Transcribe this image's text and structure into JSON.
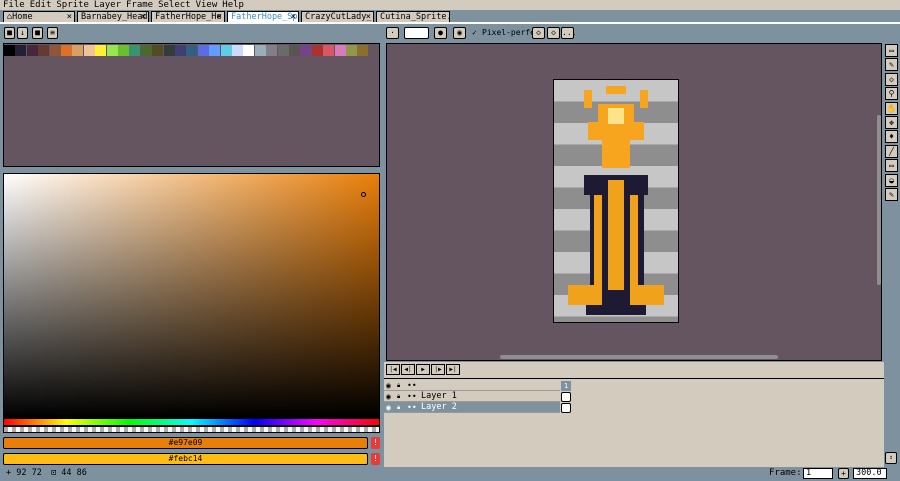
{
  "menu": [
    "File",
    "Edit",
    "Sprite",
    "Layer",
    "Frame",
    "Select",
    "View",
    "Help"
  ],
  "tabs": [
    {
      "label": "Home",
      "active": false
    },
    {
      "label": "Barnabey_Head",
      "active": false
    },
    {
      "label": "FatherHope_He",
      "active": false
    },
    {
      "label": "FatherHope_Sp",
      "active": true
    },
    {
      "label": "CrazyCutLady_",
      "active": false
    },
    {
      "label": "Cutina_Sprite.a",
      "active": false
    }
  ],
  "canvas_toolbar": {
    "pixel_perfect_label": "Pixel-perfect",
    "more_label": "..."
  },
  "palette_colors": [
    "#000000",
    "#222034",
    "#45283c",
    "#663931",
    "#8f563b",
    "#df7126",
    "#d9a066",
    "#eec39a",
    "#fbf236",
    "#99e550",
    "#6abe30",
    "#37946e",
    "#4b692f",
    "#524b24",
    "#323c39",
    "#3f3f74",
    "#306082",
    "#5b6ee1",
    "#639bff",
    "#5fcde4",
    "#cbdbfc",
    "#ffffff",
    "#9badb7",
    "#847e87",
    "#696a6a",
    "#595652",
    "#76428a",
    "#ac3232",
    "#d95763",
    "#d77bba",
    "#8f974a",
    "#8a6f30"
  ],
  "colors": {
    "foreground_label": "#e97e09",
    "background_label": "#febc14",
    "foreground": "#e97e09",
    "background": "#febc14",
    "warn_glyph": "!"
  },
  "status": {
    "cursor": "92 72",
    "selection": "44 86"
  },
  "layers": [
    {
      "name": "",
      "visible": true
    },
    {
      "name": "Layer 1",
      "visible": true
    },
    {
      "name": "Layer 2",
      "visible": true,
      "selected": true
    }
  ],
  "timeline": {
    "frame_number": "1"
  },
  "footer": {
    "frame_label": "Frame:",
    "frame_value": "1",
    "zoom_value": "300.0",
    "add_label": "+"
  }
}
